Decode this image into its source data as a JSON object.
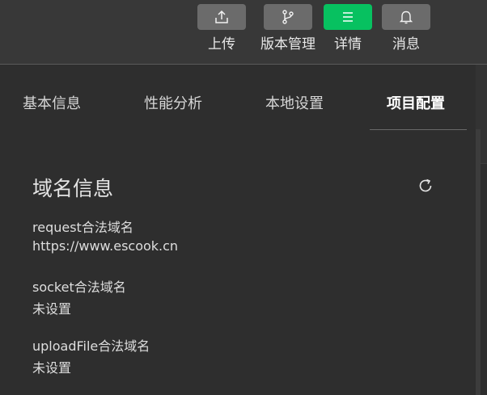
{
  "toolbar": {
    "buttons": [
      {
        "label": "上传",
        "icon": "upload-icon",
        "active": false
      },
      {
        "label": "版本管理",
        "icon": "branch-icon",
        "active": false
      },
      {
        "label": "详情",
        "icon": "menu-icon",
        "active": true
      },
      {
        "label": "消息",
        "icon": "bell-icon",
        "active": false
      }
    ],
    "active_color": "#07c160"
  },
  "tabs": [
    {
      "label": "基本信息",
      "active": false
    },
    {
      "label": "性能分析",
      "active": false
    },
    {
      "label": "本地设置",
      "active": false
    },
    {
      "label": "项目配置",
      "active": true
    }
  ],
  "domain_section": {
    "title": "域名信息",
    "refresh_icon": "refresh-icon",
    "fields": [
      {
        "label": "request合法域名",
        "value": "https://www.escook.cn"
      },
      {
        "label": "socket合法域名",
        "value": "未设置"
      },
      {
        "label": "uploadFile合法域名",
        "value": "未设置"
      }
    ]
  }
}
